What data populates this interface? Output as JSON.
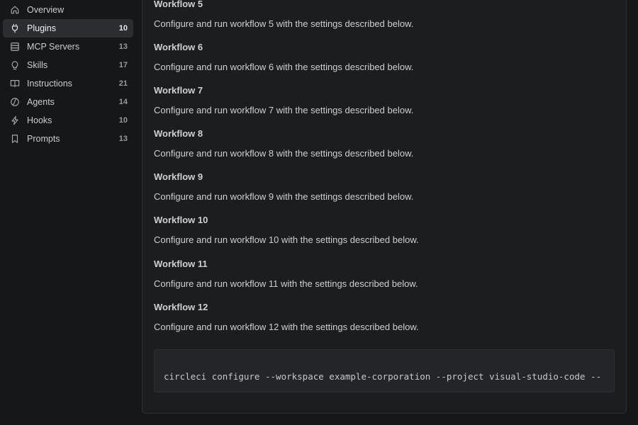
{
  "sidebar": {
    "items": [
      {
        "label": "Overview",
        "count": "",
        "icon": "home-icon"
      },
      {
        "label": "Plugins",
        "count": "10",
        "icon": "plug-icon",
        "active": true
      },
      {
        "label": "MCP Servers",
        "count": "13",
        "icon": "server-icon"
      },
      {
        "label": "Skills",
        "count": "17",
        "icon": "lightbulb-icon"
      },
      {
        "label": "Instructions",
        "count": "21",
        "icon": "book-icon"
      },
      {
        "label": "Agents",
        "count": "14",
        "icon": "agent-icon"
      },
      {
        "label": "Hooks",
        "count": "10",
        "icon": "lightning-icon"
      },
      {
        "label": "Prompts",
        "count": "13",
        "icon": "bookmark-icon"
      }
    ]
  },
  "workflows": [
    {
      "title": "Workflow 5",
      "description": "Configure and run workflow 5 with the settings described below."
    },
    {
      "title": "Workflow 6",
      "description": "Configure and run workflow 6 with the settings described below."
    },
    {
      "title": "Workflow 7",
      "description": "Configure and run workflow 7 with the settings described below."
    },
    {
      "title": "Workflow 8",
      "description": "Configure and run workflow 8 with the settings described below."
    },
    {
      "title": "Workflow 9",
      "description": "Configure and run workflow 9 with the settings described below."
    },
    {
      "title": "Workflow 10",
      "description": "Configure and run workflow 10 with the settings described below."
    },
    {
      "title": "Workflow 11",
      "description": "Configure and run workflow 11 with the settings described below."
    },
    {
      "title": "Workflow 12",
      "description": "Configure and run workflow 12 with the settings described below."
    }
  ],
  "code": {
    "command": "circleci configure --workspace example-corporation --project visual-studio-code --"
  }
}
